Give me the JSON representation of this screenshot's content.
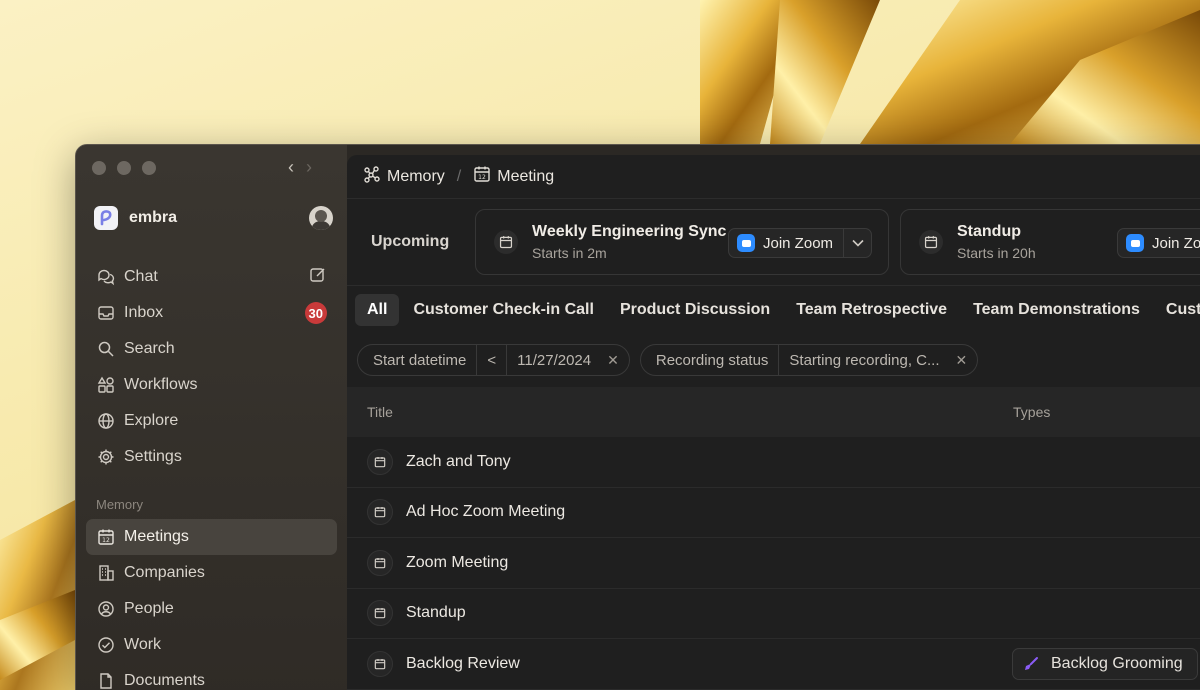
{
  "app": {
    "workspace_name": "embra"
  },
  "sidebar": {
    "items": [
      {
        "label": "Chat",
        "icon": "chat-icon"
      },
      {
        "label": "Inbox",
        "icon": "inbox-icon",
        "badge": "30"
      },
      {
        "label": "Search",
        "icon": "search-icon"
      },
      {
        "label": "Workflows",
        "icon": "workflows-icon"
      },
      {
        "label": "Explore",
        "icon": "globe-icon"
      },
      {
        "label": "Settings",
        "icon": "gear-icon"
      }
    ],
    "memory_label": "Memory",
    "memory_items": [
      {
        "label": "Meetings",
        "icon": "calendar-icon",
        "active": true
      },
      {
        "label": "Companies",
        "icon": "building-icon"
      },
      {
        "label": "People",
        "icon": "person-icon"
      },
      {
        "label": "Work",
        "icon": "check-circle-icon"
      },
      {
        "label": "Documents",
        "icon": "document-icon"
      }
    ]
  },
  "breadcrumb": {
    "root": "Memory",
    "separator": "/",
    "current": "Meeting"
  },
  "upcoming": {
    "label": "Upcoming",
    "meetings": [
      {
        "title": "Weekly Engineering Sync",
        "subtitle": "Starts in 2m",
        "join_label": "Join Zoom"
      },
      {
        "title": "Standup",
        "subtitle": "Starts in 20h",
        "join_label": "Join Zoom"
      }
    ]
  },
  "tabs": [
    "All",
    "Customer Check-in Call",
    "Product Discussion",
    "Team Retrospective",
    "Team Demonstrations",
    "Customer"
  ],
  "filters": {
    "date": {
      "field": "Start datetime",
      "operator": "<",
      "value": "11/27/2024"
    },
    "recording": {
      "field": "Recording status",
      "value": "Starting recording, C..."
    }
  },
  "table": {
    "columns": {
      "title": "Title",
      "types": "Types"
    },
    "rows": [
      {
        "title": "Zach and Tony",
        "type": ""
      },
      {
        "title": "Ad Hoc Zoom Meeting",
        "type": ""
      },
      {
        "title": "Zoom Meeting",
        "type": ""
      },
      {
        "title": "Standup",
        "type": ""
      },
      {
        "title": "Backlog Review",
        "type": "Backlog Grooming"
      }
    ]
  },
  "colors": {
    "accent_zoom": "#2d8cff",
    "badge_red": "#c93a3a",
    "type_purple": "#8b5cf6"
  }
}
